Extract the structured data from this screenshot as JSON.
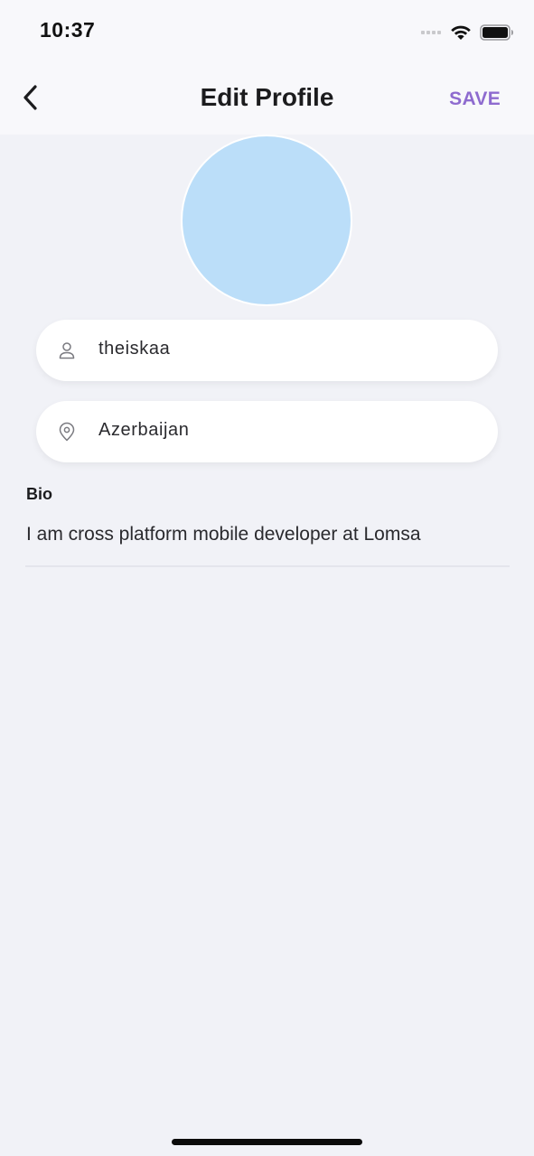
{
  "status_bar": {
    "time": "10:37"
  },
  "nav": {
    "title": "Edit Profile",
    "save_label": "SAVE"
  },
  "profile": {
    "avatar_color": "#bbdef9",
    "username": "theiskaa",
    "location": "Azerbaijan"
  },
  "bio": {
    "label": "Bio",
    "text": "I am cross platform mobile developer at Lomsa"
  },
  "icons": {
    "back": "chevron-left-icon",
    "username": "person-icon",
    "location": "location-pin-icon",
    "signal": "signal-icon",
    "wifi": "wifi-icon",
    "battery": "battery-icon"
  },
  "colors": {
    "accent": "#8e6bcf",
    "background": "#f1f2f7",
    "bar_background": "#f8f8fb"
  }
}
